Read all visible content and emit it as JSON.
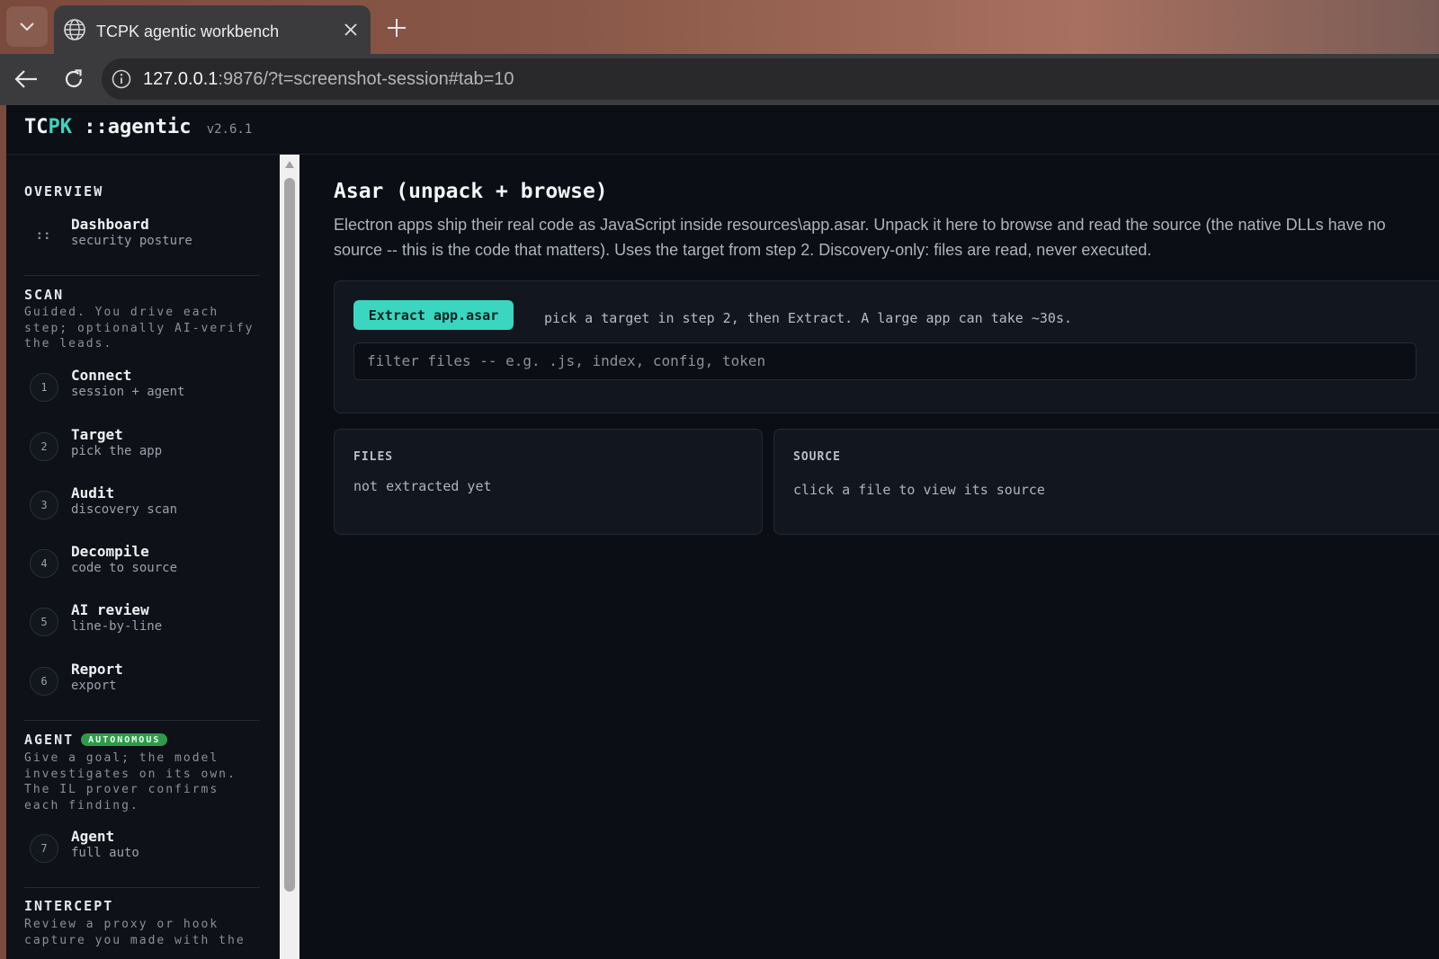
{
  "browser": {
    "tab_title": "TCPK agentic workbench",
    "url_host": "127.0.0.1",
    "url_rest": ":9876/?t=screenshot-session#tab=10",
    "icons": [
      "chevron-down-icon",
      "globe-icon",
      "close-icon",
      "plus-icon",
      "back-arrow-icon",
      "reload-icon",
      "info-icon"
    ]
  },
  "app": {
    "brand_tc": "TC",
    "brand_pk": "PK",
    "brand_suffix": " ::agentic",
    "version": "v2.6.1",
    "accent_color": "#3ad6bf"
  },
  "sidebar": {
    "overview": {
      "title": "OVERVIEW",
      "items": [
        {
          "glyph": "::",
          "label": "Dashboard",
          "sub": "security posture"
        }
      ]
    },
    "scan": {
      "title": "SCAN",
      "desc": "Guided. You drive each\nstep; optionally AI-verify\nthe leads.",
      "items": [
        {
          "num": "1",
          "label": "Connect",
          "sub": "session + agent"
        },
        {
          "num": "2",
          "label": "Target",
          "sub": "pick the app"
        },
        {
          "num": "3",
          "label": "Audit",
          "sub": "discovery scan"
        },
        {
          "num": "4",
          "label": "Decompile",
          "sub": "code to source"
        },
        {
          "num": "5",
          "label": "AI review",
          "sub": "line-by-line"
        },
        {
          "num": "6",
          "label": "Report",
          "sub": "export"
        }
      ]
    },
    "agent": {
      "title": "AGENT",
      "badge": "AUTONOMOUS",
      "badge_color": "#2f9a4a",
      "desc": "Give a goal; the model\ninvestigates on its own.\nThe IL prover confirms\neach finding.",
      "items": [
        {
          "num": "7",
          "label": "Agent",
          "sub": "full auto"
        }
      ]
    },
    "intercept": {
      "title": "INTERCEPT",
      "desc": "Review a proxy or hook\ncapture you made with the"
    }
  },
  "main": {
    "title": "Asar (unpack + browse)",
    "desc": "Electron apps ship their real code as JavaScript inside resources\\app.asar. Unpack it here to browse and read the source (the native DLLs have no source -- this is the code that matters). Uses the target from step 2. Discovery-only: files are read, never executed.",
    "extract_label": "Extract app.asar",
    "hint": "pick a target in step 2, then Extract. A large app can take ~30s.",
    "filter_placeholder": "filter files -- e.g. .js, index, config, token",
    "files_title": "FILES",
    "files_empty": "not extracted yet",
    "source_title": "SOURCE",
    "source_empty": "click a file to view its source"
  }
}
